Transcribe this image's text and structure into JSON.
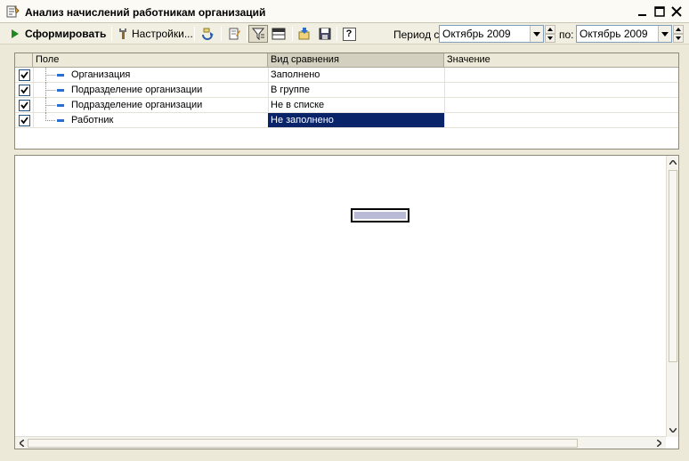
{
  "window": {
    "title": "Анализ начислений работникам организаций"
  },
  "toolbar": {
    "generate_label": "Сформировать",
    "settings_label": "Настройки...",
    "period_from_label": "Период с:",
    "period_to_label": "по:",
    "period_from_value": "Октябрь 2009",
    "period_to_value": "Октябрь 2009",
    "help_label": "?"
  },
  "filter_grid": {
    "columns": [
      "Поле",
      "Вид сравнения",
      "Значение"
    ],
    "rows": [
      {
        "field": "Организация",
        "comparison": "Заполнено",
        "value": ""
      },
      {
        "field": "Подразделение организации",
        "comparison": "В группе",
        "value": ""
      },
      {
        "field": "Подразделение организации",
        "comparison": "Не в списке",
        "value": ""
      },
      {
        "field": "Работник",
        "comparison": "Не заполнено",
        "value": ""
      }
    ]
  },
  "colors": {
    "selection": "#0a246a",
    "play_green": "#1f8a1f"
  }
}
